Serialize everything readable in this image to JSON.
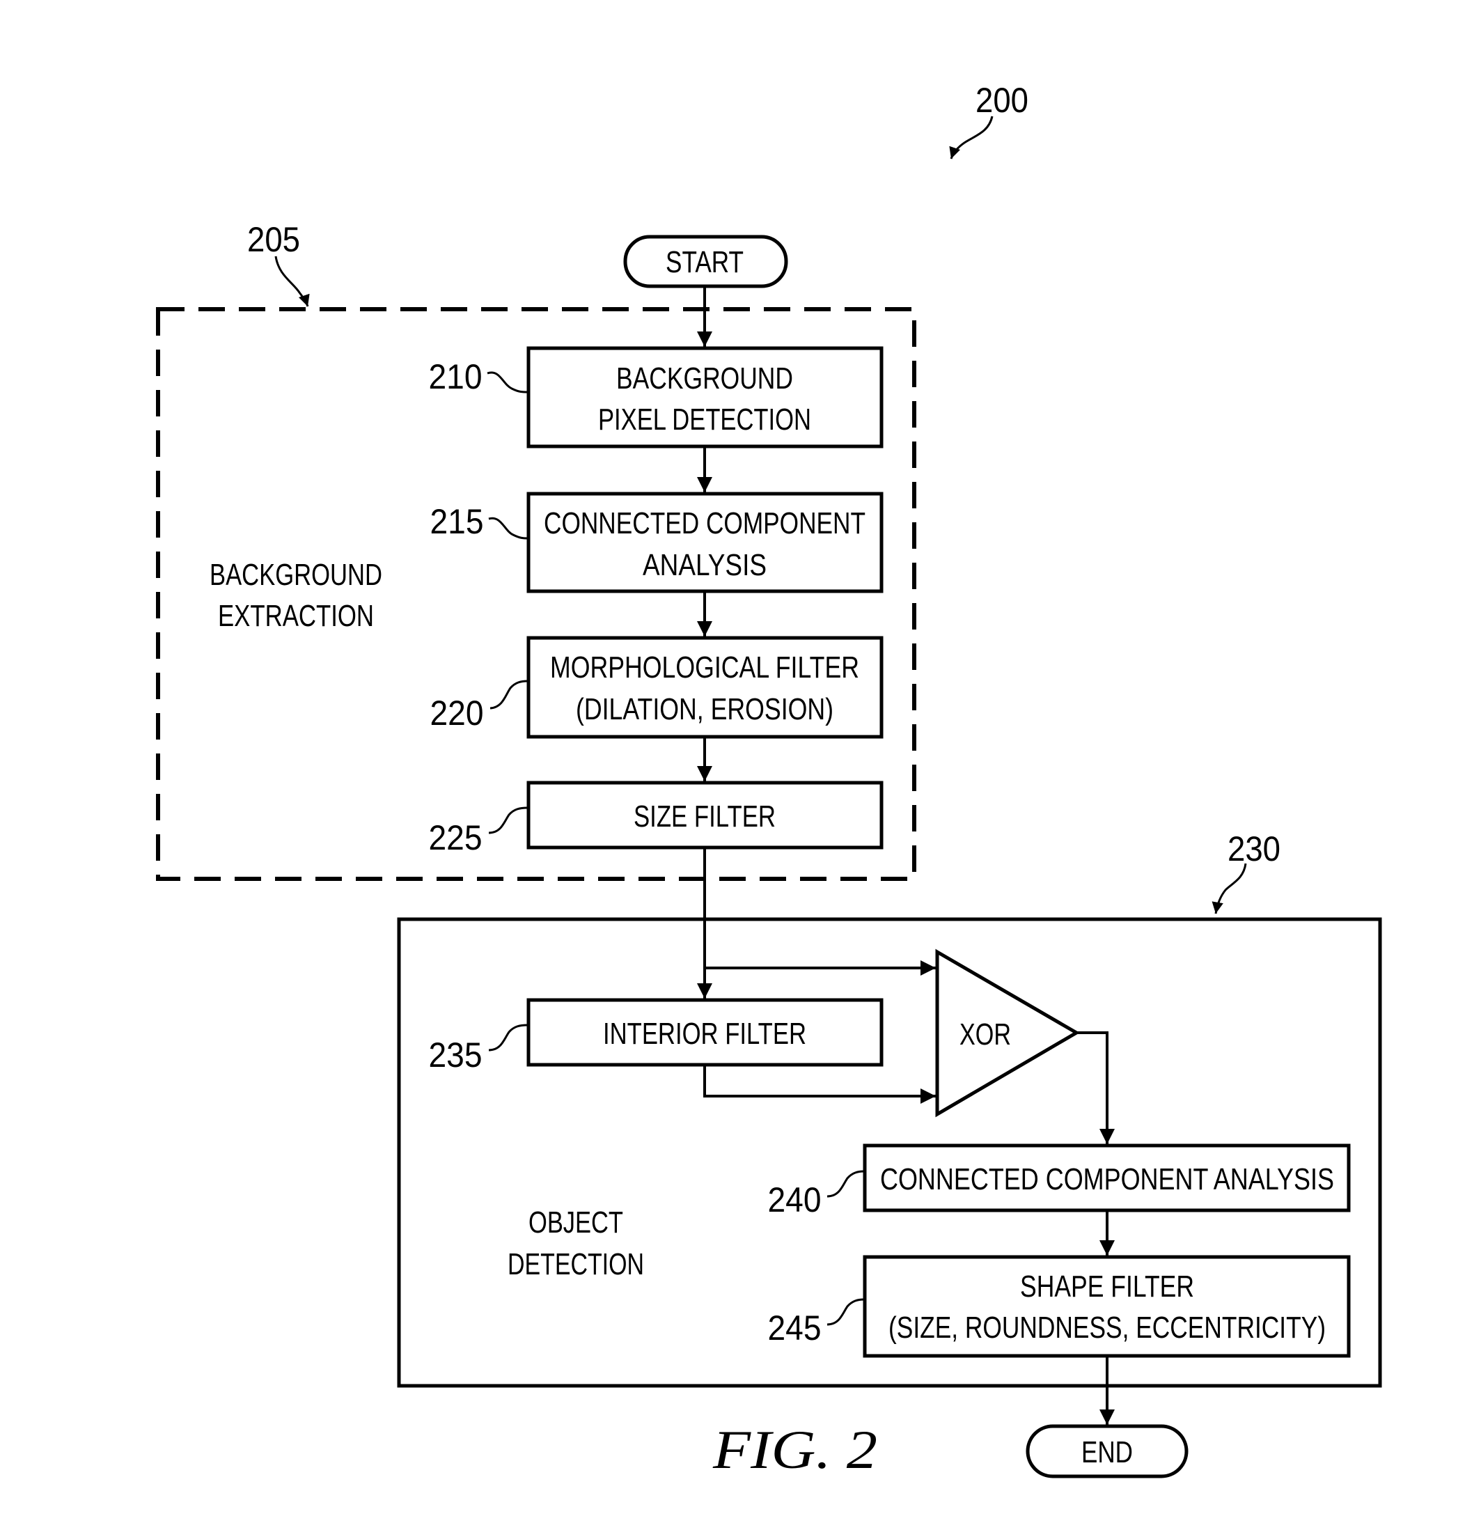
{
  "figure": {
    "caption": "FIG. 2",
    "ref_number": "200"
  },
  "terminals": {
    "start": "START",
    "end": "END"
  },
  "groups": {
    "background_extraction": {
      "ref": "205",
      "label_line1": "BACKGROUND",
      "label_line2": "EXTRACTION",
      "border_style": "dashed"
    },
    "object_detection": {
      "ref": "230",
      "label_line1": "OBJECT",
      "label_line2": "DETECTION",
      "border_style": "solid"
    }
  },
  "steps": [
    {
      "ref": "210",
      "line1": "BACKGROUND",
      "line2": "PIXEL DETECTION"
    },
    {
      "ref": "215",
      "line1": "CONNECTED COMPONENT",
      "line2": "ANALYSIS"
    },
    {
      "ref": "220",
      "line1": "MORPHOLOGICAL FILTER",
      "line2": "(DILATION, EROSION)"
    },
    {
      "ref": "225",
      "line1": "SIZE FILTER"
    },
    {
      "ref": "235",
      "line1": "INTERIOR FILTER"
    },
    {
      "ref": "240",
      "line1": "CONNECTED COMPONENT ANALYSIS"
    },
    {
      "ref": "245",
      "line1": "SHAPE FILTER",
      "line2": "(SIZE, ROUNDNESS, ECCENTRICITY)"
    }
  ],
  "gate": {
    "label": "XOR"
  }
}
